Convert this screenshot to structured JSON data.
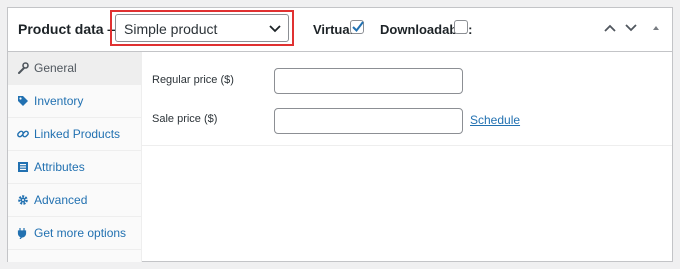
{
  "header": {
    "title": "Product data —",
    "product_type": {
      "selected": "Simple product"
    },
    "virtual": {
      "label": "Virtual:",
      "checked": true
    },
    "downloadable": {
      "label": "Downloadable:",
      "checked": false
    },
    "controls": [
      "chevron-up-icon",
      "chevron-down-icon",
      "collapse-triangle-icon"
    ]
  },
  "sidebar": {
    "items": [
      {
        "label": "General",
        "icon": "wrench-icon",
        "active": true
      },
      {
        "label": "Inventory",
        "icon": "tag-icon",
        "active": false
      },
      {
        "label": "Linked Products",
        "icon": "link-icon",
        "active": false
      },
      {
        "label": "Attributes",
        "icon": "list-icon",
        "active": false
      },
      {
        "label": "Advanced",
        "icon": "gear-icon",
        "active": false
      },
      {
        "label": "Get more options",
        "icon": "plugin-icon",
        "active": false
      }
    ]
  },
  "general": {
    "regular_price": {
      "label": "Regular price ($)",
      "value": ""
    },
    "sale_price": {
      "label": "Sale price ($)",
      "value": ""
    },
    "schedule_link": "Schedule"
  },
  "colors": {
    "link": "#2271b1",
    "highlight": "#e03131",
    "active_tab_bg": "#eeeeee",
    "sidebar_bg": "#fafafa"
  }
}
